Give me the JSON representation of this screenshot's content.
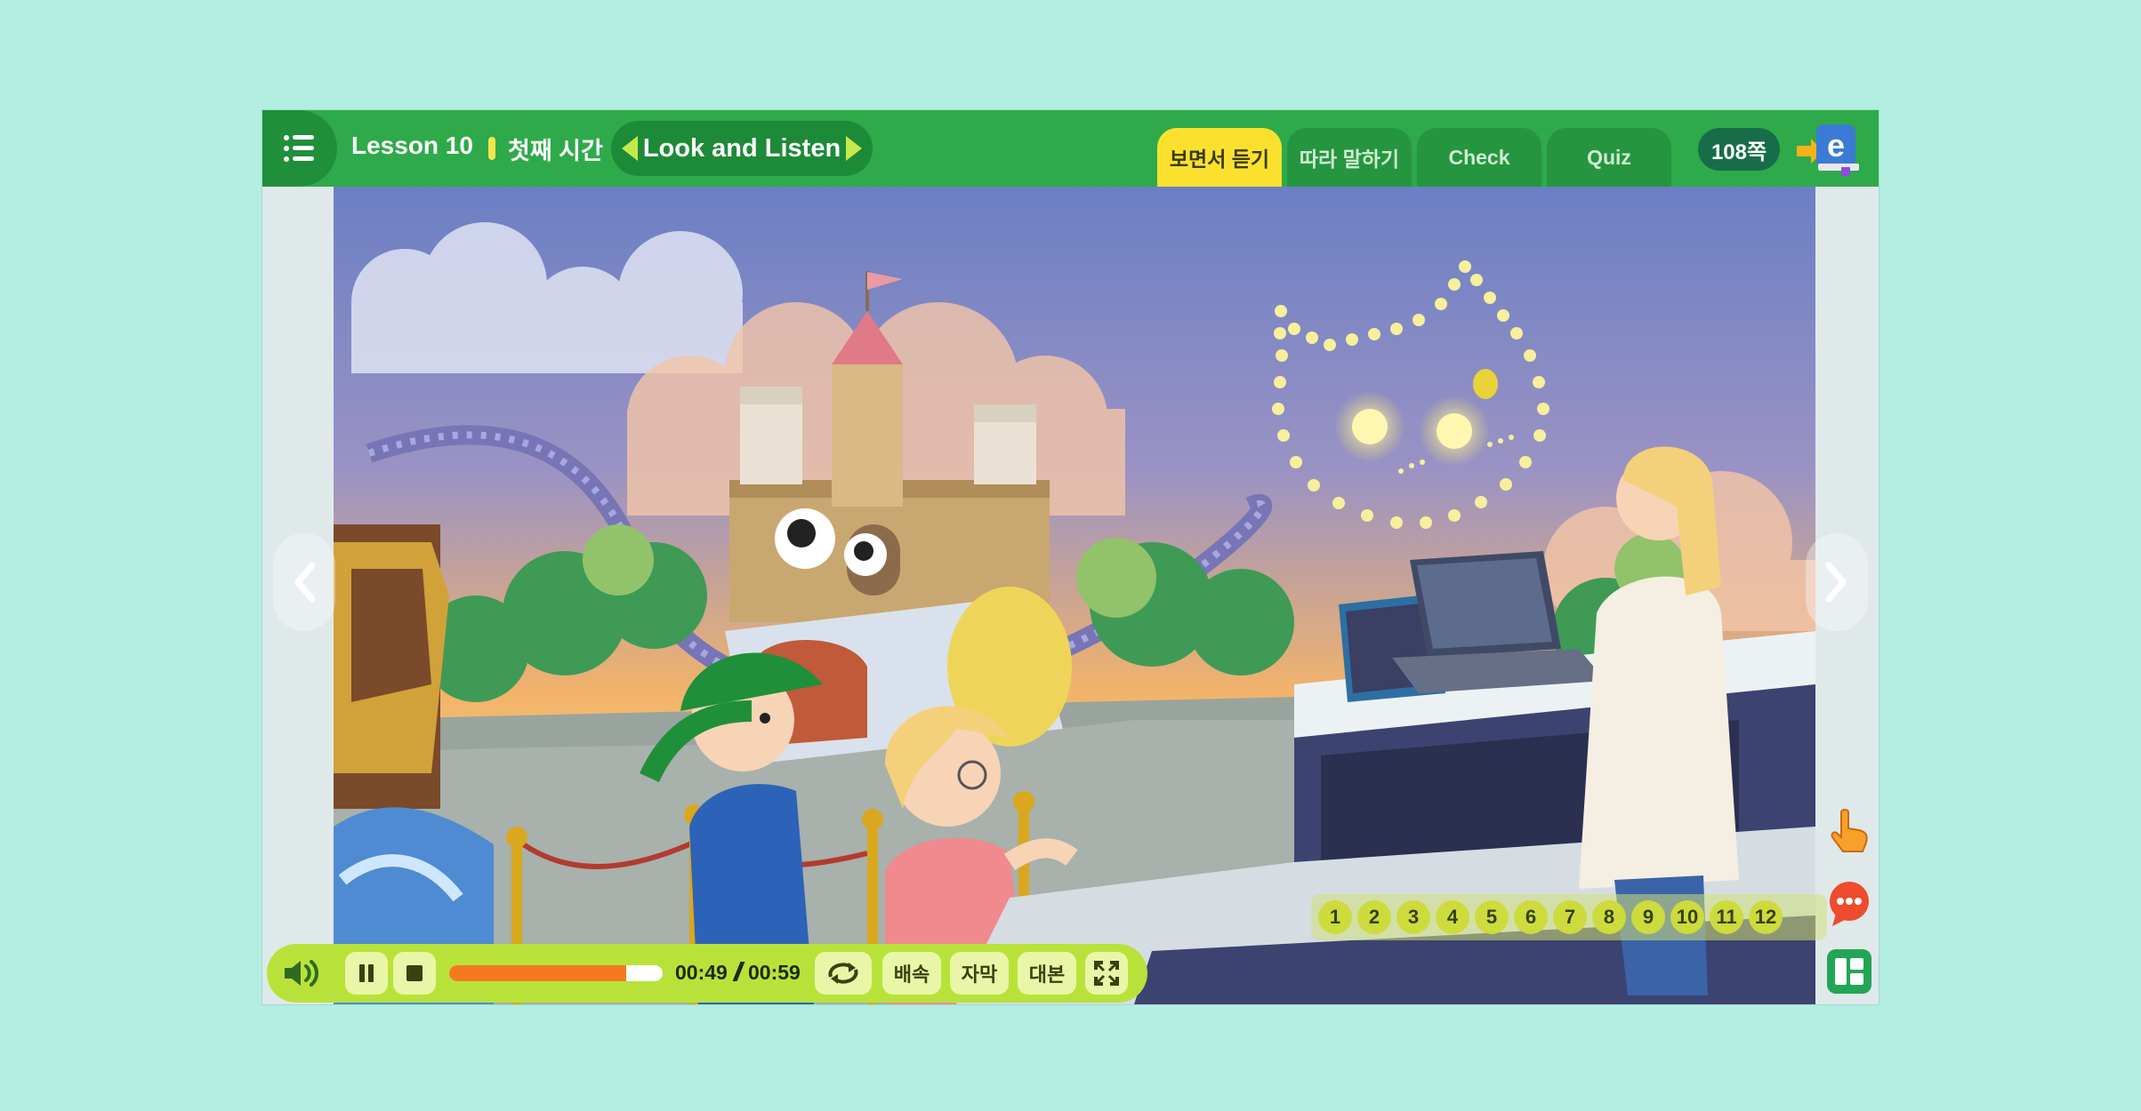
{
  "header": {
    "lesson": "Lesson 10",
    "period": "첫째 시간",
    "activity": "Look and Listen",
    "tabs": [
      {
        "label": "보면서 듣기",
        "active": true
      },
      {
        "label": "따라 말하기",
        "active": false
      },
      {
        "label": "Check",
        "active": false
      },
      {
        "label": "Quiz",
        "active": false
      }
    ],
    "page": "108쪽",
    "logo_letter": "e"
  },
  "scene_pages": [
    "1",
    "2",
    "3",
    "4",
    "5",
    "6",
    "7",
    "8",
    "9",
    "10",
    "11",
    "12"
  ],
  "player": {
    "current_time": "00:49",
    "total_time": "00:59",
    "progress": 0.83,
    "speed_label": "배속",
    "subtitle_label": "자막",
    "script_label": "대본"
  },
  "colors": {
    "background": "#b3eee2",
    "topbar": "#2eaa4a",
    "active_tab": "#fbe12e",
    "player": "#b8e23a",
    "progress_fill": "#f57a1f"
  },
  "icons": [
    "menu-icon",
    "speaker-icon",
    "pause-icon",
    "stop-icon",
    "repeat-icon",
    "fullscreen-icon",
    "hand-pointer-icon",
    "chat-bubble-icon",
    "layout-icon",
    "chevron-left-icon",
    "chevron-right-icon"
  ]
}
